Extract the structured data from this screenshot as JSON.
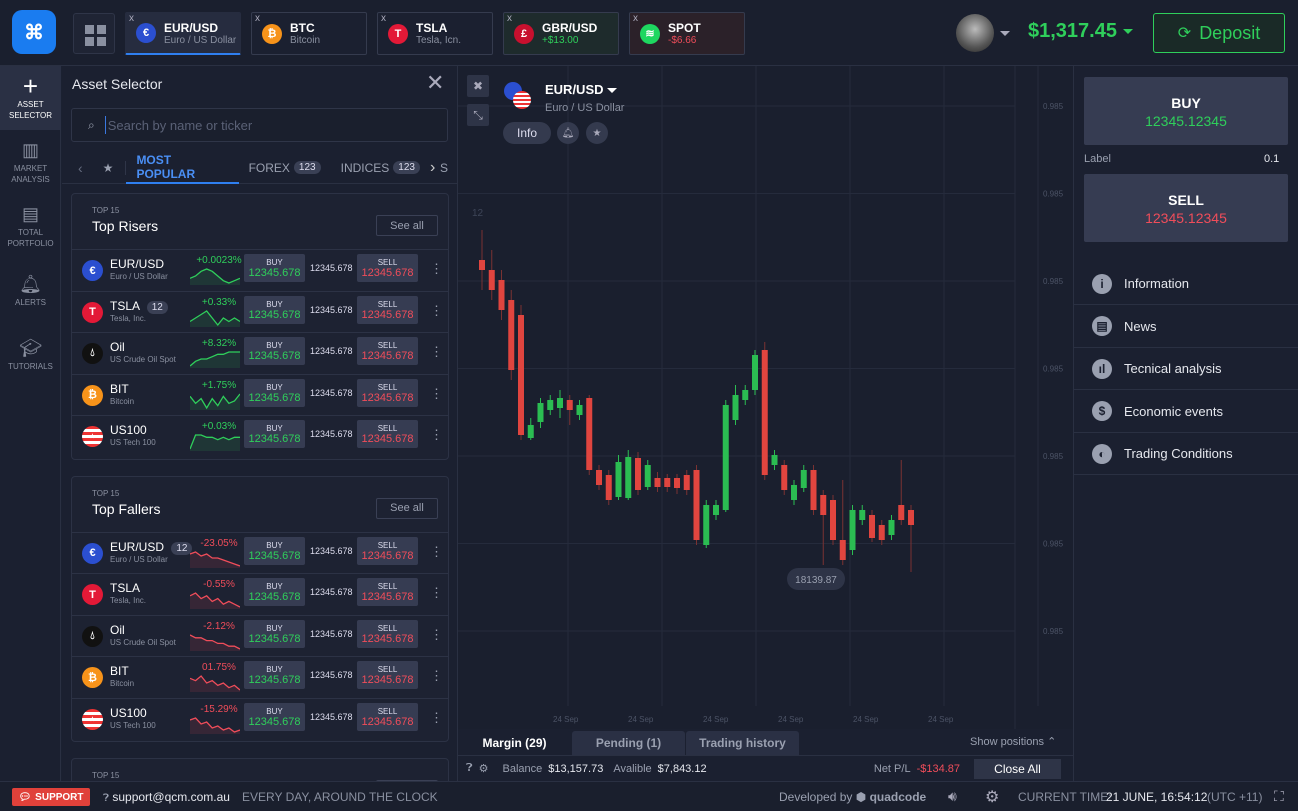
{
  "colors": {
    "green": "#2fcf5b",
    "red": "#f04d5a",
    "accent": "#2f7ff0",
    "brand": "#1a7cf0"
  },
  "topbar": {
    "logo_icon": "qcm-logo",
    "grid_icon": "grid-icon",
    "tabs": [
      {
        "ticker": "EUR/USD",
        "sub": "Euro / US Dollar",
        "icon": "eur-usd-flag-icon",
        "state": "active"
      },
      {
        "ticker": "BTC",
        "sub": "Bitcoin",
        "icon": "bitcoin-icon",
        "state": "normal"
      },
      {
        "ticker": "TSLA",
        "sub": "Tesla, Icn.",
        "icon": "tesla-icon",
        "state": "normal"
      },
      {
        "ticker": "GBR/USD",
        "sub": "+$13.00",
        "icon": "gbp-usd-flag-icon",
        "state": "positive"
      },
      {
        "ticker": "SPOT",
        "sub": "-$6.66",
        "icon": "spotify-icon",
        "state": "negative"
      }
    ],
    "close_glyph": "x",
    "balance": "$1,317.45",
    "deposit_label": "Deposit"
  },
  "leftnav": [
    {
      "label": "ASSET SELECTOR",
      "icon": "plus-icon",
      "glyph": "+",
      "active": true
    },
    {
      "label": "MARKET ANALYSIS",
      "icon": "bar-chart-icon",
      "glyph": "▥",
      "active": false
    },
    {
      "label": "TOTAL PORTFOLIO",
      "icon": "briefcase-icon",
      "glyph": "▤",
      "active": false
    },
    {
      "label": "ALERTS",
      "icon": "bell-icon",
      "glyph": "🔔︎",
      "active": false
    },
    {
      "label": "TUTORIALS",
      "icon": "graduation-cap-icon",
      "glyph": "🎓︎",
      "active": false
    }
  ],
  "asset_selector": {
    "title": "Asset Selector",
    "search_placeholder": "Search by name or ticker",
    "categories": [
      {
        "label": "MOST POPULAR",
        "active": true
      },
      {
        "label": "FOREX",
        "count": "123"
      },
      {
        "label": "INDICES",
        "count": "123"
      },
      {
        "label": "S"
      }
    ],
    "see_all": "See all",
    "buy": "BUY",
    "sell": "SELL",
    "sections": [
      {
        "top": "TOP 15",
        "title": "Top Risers",
        "rows": [
          {
            "name": "EUR/USD",
            "sub": "Euro / US Dollar",
            "badge": "",
            "pct": "+0.0023%",
            "dir": "up",
            "buy": "12345.678",
            "mid": "12345.678",
            "sell": "12345.678",
            "spark": [
              6,
              7,
              9,
              10,
              9,
              7,
              5,
              4,
              5,
              6
            ]
          },
          {
            "name": "TSLA",
            "sub": "Tesla, Inc.",
            "badge": "12",
            "pct": "+0.33%",
            "dir": "up",
            "buy": "12345.678",
            "mid": "12345.678",
            "sell": "12345.678",
            "spark": [
              6,
              7,
              8,
              9,
              7,
              5,
              7,
              6,
              7,
              6
            ]
          },
          {
            "name": "Oil",
            "sub": "US Crude Oil Spot",
            "badge": "",
            "pct": "+8.32%",
            "dir": "up",
            "buy": "12345.678",
            "mid": "12345.678",
            "sell": "12345.678",
            "spark": [
              2,
              4,
              5,
              5,
              6,
              7,
              7,
              8,
              8,
              8
            ]
          },
          {
            "name": "BIT",
            "sub": "Bitcoin",
            "badge": "",
            "pct": "+1.75%",
            "dir": "up",
            "buy": "12345.678",
            "mid": "12345.678",
            "sell": "12345.678",
            "spark": [
              8,
              5,
              7,
              3,
              7,
              4,
              8,
              5,
              6,
              9
            ]
          },
          {
            "name": "US100",
            "sub": "US Tech 100",
            "badge": "",
            "pct": "+0.03%",
            "dir": "up",
            "buy": "12345.678",
            "mid": "12345.678",
            "sell": "12345.678",
            "spark": [
              2,
              8,
              8,
              7,
              7,
              6,
              7,
              6,
              7,
              7
            ]
          }
        ]
      },
      {
        "top": "TOP 15",
        "title": "Top Fallers",
        "rows": [
          {
            "name": "EUR/USD",
            "sub": "Euro / US Dollar",
            "badge": "12",
            "pct": "-23.05%",
            "dir": "down",
            "buy": "12345.678",
            "mid": "12345.678",
            "sell": "12345.678",
            "spark": [
              8,
              9,
              7,
              8,
              6,
              6,
              5,
              4,
              3,
              2
            ]
          },
          {
            "name": "TSLA",
            "sub": "Tesla, Inc.",
            "badge": "",
            "pct": "-0.55%",
            "dir": "down",
            "buy": "12345.678",
            "mid": "12345.678",
            "sell": "12345.678",
            "spark": [
              7,
              8,
              6,
              7,
              5,
              6,
              4,
              5,
              4,
              3
            ]
          },
          {
            "name": "Oil",
            "sub": "US Crude Oil Spot",
            "badge": "",
            "pct": "-2.12%",
            "dir": "down",
            "buy": "12345.678",
            "mid": "12345.678",
            "sell": "12345.678",
            "spark": [
              8,
              7,
              7,
              6,
              6,
              5,
              5,
              4,
              4,
              3
            ]
          },
          {
            "name": "BIT",
            "sub": "Bitcoin",
            "badge": "",
            "pct": "01.75%",
            "dir": "down",
            "buy": "12345.678",
            "mid": "12345.678",
            "sell": "12345.678",
            "spark": [
              7,
              6,
              8,
              5,
              6,
              4,
              5,
              3,
              4,
              2
            ]
          },
          {
            "name": "US100",
            "sub": "US Tech 100",
            "badge": "",
            "pct": "-15.29%",
            "dir": "down",
            "buy": "12345.678",
            "mid": "12345.678",
            "sell": "12345.678",
            "spark": [
              8,
              9,
              6,
              7,
              4,
              5,
              3,
              4,
              2,
              3
            ]
          }
        ]
      },
      {
        "top": "TOP 15",
        "title": "",
        "rows": []
      }
    ]
  },
  "chart_header": {
    "ticker": "EUR/USD",
    "sub": "Euro / US Dollar",
    "info": "Info",
    "bell_icon": "bell-icon",
    "star_icon": "star-icon",
    "close_icon": "close-icon",
    "collapse_icon": "collapse-icon"
  },
  "chart_data": {
    "type": "candlestick",
    "y_tick_labels": [
      "0.985",
      "0.985",
      "0.985",
      "0.985",
      "0.985",
      "0.985",
      "0.985"
    ],
    "x_tick_labels": [
      "24 Sep",
      "24 Sep",
      "24 Sep",
      "24 Sep",
      "24 Sep",
      "24 Sep"
    ],
    "price_tag": "18139.87",
    "left_tag": "12",
    "grid": true,
    "candles_ohlc": [
      [
        0.9864,
        0.9863,
        0.9867,
        0.9861
      ],
      [
        0.9863,
        0.9861,
        0.9865,
        0.986
      ],
      [
        0.9862,
        0.9859,
        0.9863,
        0.9858
      ],
      [
        0.986,
        0.9853,
        0.9861,
        0.9852
      ],
      [
        0.98585,
        0.98465,
        0.98595,
        0.9846
      ],
      [
        0.98462,
        0.98475,
        0.98482,
        0.9846
      ],
      [
        0.98478,
        0.98497,
        0.98502,
        0.98472
      ],
      [
        0.9849,
        0.985,
        0.98505,
        0.98485
      ],
      [
        0.98492,
        0.98502,
        0.9851,
        0.98482
      ],
      [
        0.985,
        0.9849,
        0.98505,
        0.98475
      ],
      [
        0.98485,
        0.98495,
        0.985,
        0.9848
      ],
      [
        0.98502,
        0.9843,
        0.98505,
        0.98425
      ],
      [
        0.9843,
        0.98415,
        0.98435,
        0.9841
      ],
      [
        0.98425,
        0.984,
        0.9843,
        0.98395
      ],
      [
        0.98403,
        0.98438,
        0.98445,
        0.984
      ],
      [
        0.98402,
        0.98443,
        0.9845,
        0.984
      ],
      [
        0.98442,
        0.9841,
        0.98448,
        0.98405
      ],
      [
        0.98413,
        0.98435,
        0.9844,
        0.9841
      ],
      [
        0.98422,
        0.98413,
        0.98428,
        0.98408
      ],
      [
        0.98422,
        0.98413,
        0.98426,
        0.98408
      ],
      [
        0.98422,
        0.98412,
        0.98426,
        0.98406
      ],
      [
        0.98425,
        0.9841,
        0.9843,
        0.98405
      ],
      [
        0.9843,
        0.9836,
        0.98435,
        0.98355
      ],
      [
        0.98355,
        0.98395,
        0.984,
        0.98352
      ],
      [
        0.98385,
        0.98395,
        0.984,
        0.9838
      ],
      [
        0.9839,
        0.98495,
        0.985,
        0.98388
      ],
      [
        0.9848,
        0.98505,
        0.98515,
        0.98475
      ],
      [
        0.985,
        0.9851,
        0.98515,
        0.98495
      ],
      [
        0.9851,
        0.98545,
        0.9855,
        0.98505
      ],
      [
        0.9855,
        0.98425,
        0.98558,
        0.9842
      ],
      [
        0.98435,
        0.98445,
        0.9845,
        0.9843
      ],
      [
        0.98435,
        0.9841,
        0.9844,
        0.98405
      ],
      [
        0.984,
        0.98415,
        0.9842,
        0.98395
      ],
      [
        0.98412,
        0.9843,
        0.98435,
        0.98408
      ],
      [
        0.9843,
        0.9839,
        0.98435,
        0.98385
      ],
      [
        0.98405,
        0.98385,
        0.9841,
        0.98335
      ],
      [
        0.984,
        0.9836,
        0.98405,
        0.98355
      ],
      [
        0.9836,
        0.9834,
        0.9842,
        0.98335
      ],
      [
        0.9835,
        0.9839,
        0.98395,
        0.98345
      ],
      [
        0.9838,
        0.9839,
        0.98395,
        0.98375
      ],
      [
        0.98385,
        0.98362,
        0.9839,
        0.98358
      ],
      [
        0.98375,
        0.9836,
        0.9838,
        0.98355
      ],
      [
        0.98365,
        0.9838,
        0.98385,
        0.9836
      ],
      [
        0.98395,
        0.9838,
        0.9844,
        0.98375
      ],
      [
        0.9839,
        0.98375,
        0.98395,
        0.98328
      ]
    ]
  },
  "positions": {
    "tabs": [
      {
        "label": "Margin (29)",
        "active": true
      },
      {
        "label": "Pending (1)"
      },
      {
        "label": "Trading history"
      }
    ],
    "show_positions": "Show positions",
    "balance_label": "Balance",
    "balance": "$13,157.73",
    "available_label": "Avalible",
    "available": "$7,843.12",
    "netpl_label": "Net P/L",
    "netpl": "-$134.87",
    "close_all": "Close All"
  },
  "right_panel": {
    "buy_label": "BUY",
    "buy_price": "12345.12345",
    "sell_label": "SELL",
    "sell_price": "12345.12345",
    "label": "Label",
    "label_value": "0.1",
    "items": [
      {
        "label": "Information",
        "icon": "info-icon",
        "glyph": "i"
      },
      {
        "label": "News",
        "icon": "news-icon",
        "glyph": "▤"
      },
      {
        "label": "Tecnical analysis",
        "icon": "technical-analysis-icon",
        "glyph": "ıl"
      },
      {
        "label": "Economic events",
        "icon": "dollar-icon",
        "glyph": "$"
      },
      {
        "label": "Trading Conditions",
        "icon": "conditions-icon",
        "glyph": "◐"
      }
    ]
  },
  "footer": {
    "support": "SUPPORT",
    "email": "support@qcm.com.au",
    "hours": "EVERY DAY, AROUND THE CLOCK",
    "developed_by": "Developed by",
    "developer": "quadcode",
    "current_time_label": "CURRENT TIME:",
    "current_time": "21 JUNE, 16:54:12",
    "timezone": "(UTC +11)"
  }
}
